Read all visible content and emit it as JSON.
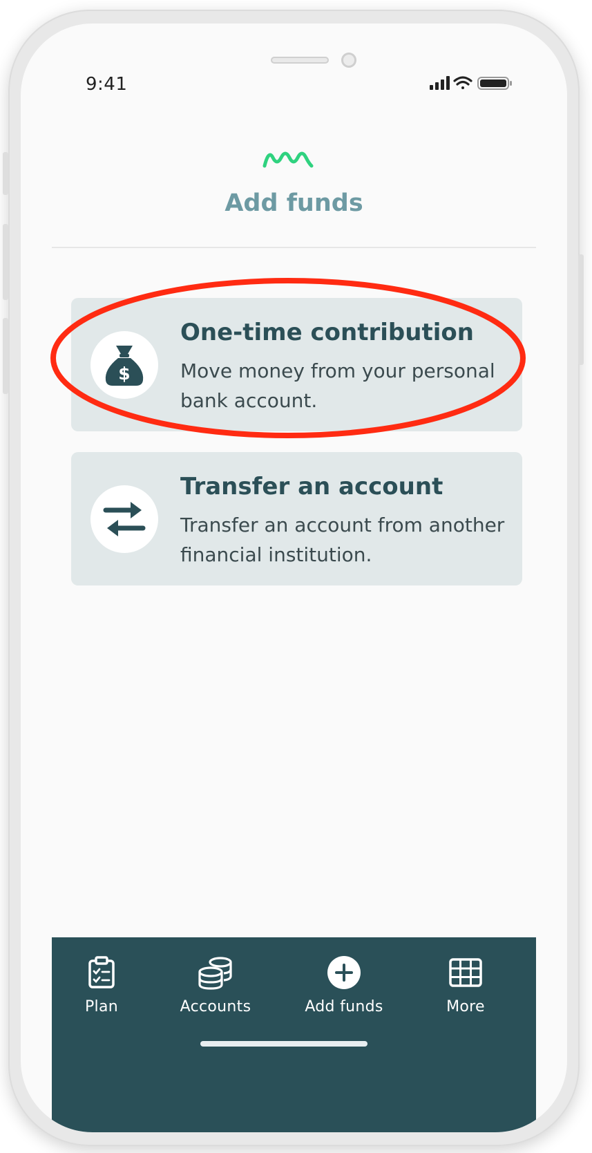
{
  "status_bar": {
    "time": "9:41"
  },
  "header": {
    "title": "Add funds"
  },
  "options": [
    {
      "title": "One-time contribution",
      "description": "Move money from your personal bank account.",
      "icon": "money-bag-icon",
      "highlighted": true
    },
    {
      "title": "Transfer an account",
      "description": "Transfer an account from another financial institution.",
      "icon": "transfer-arrows-icon",
      "highlighted": false
    }
  ],
  "tabbar": {
    "items": [
      {
        "label": "Plan",
        "icon": "clipboard-icon"
      },
      {
        "label": "Accounts",
        "icon": "coins-icon"
      },
      {
        "label": "Add funds",
        "icon": "plus-circle-icon"
      },
      {
        "label": "More",
        "icon": "grid-icon"
      }
    ]
  },
  "colors": {
    "brand_green": "#2fd27f",
    "dark_teal": "#2a5058",
    "card_bg": "#e1e8e9",
    "title_teal": "#6d9aa3",
    "highlight_red": "#ff2b12"
  }
}
